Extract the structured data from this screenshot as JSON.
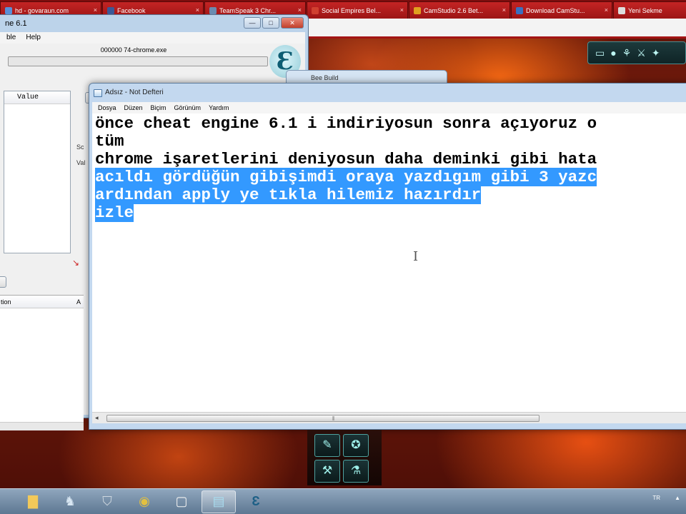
{
  "browser": {
    "tabs": [
      {
        "label": "hd - govaraun.com",
        "icon_color": "#5a8fd6"
      },
      {
        "label": "Facebook",
        "icon_color": "#3b5998"
      },
      {
        "label": "TeamSpeak 3 Chr...",
        "icon_color": "#6b8bb0"
      },
      {
        "label": "Social Empires Bel...",
        "icon_color": "#d04030"
      },
      {
        "label": "CamStudio 2.6 Bet...",
        "icon_color": "#e0a020"
      },
      {
        "label": "Download CamStu...",
        "icon_color": "#3a70c0"
      },
      {
        "label": "Yeni Sekme",
        "icon_color": "#dddddd"
      }
    ],
    "tab_close_glyph": "×"
  },
  "cheat_engine": {
    "title": "ne 6.1",
    "menu": [
      "ble",
      "Help"
    ],
    "process": "000000 74-chrome.exe",
    "list_header": "Value",
    "label_sc": "Sc",
    "label_val": "Val",
    "table_head_left": "tion",
    "table_head_right": "A",
    "logo_glyph": "Ɛ"
  },
  "background_window": {
    "title": "Bee Build"
  },
  "notepad": {
    "title": "Adsız - Not Defteri",
    "menu": [
      "Dosya",
      "Düzen",
      "Biçim",
      "Görünüm",
      "Yardım"
    ],
    "lines": [
      {
        "text": "önce cheat engine 6.1 i indiriyosun sonra açıyoruz o",
        "selected": false
      },
      {
        "text": "tüm",
        "selected": false
      },
      {
        "text": "chrome işaretlerini deniyosun daha deminki gibi hata",
        "selected": false
      },
      {
        "text": "acıldı gördüğün gibişimdi oraya yazdıgım gibi 3 yazc",
        "selected": true
      },
      {
        "text": "ardından apply ye tıkla hilemiz hazırdır",
        "selected": true
      },
      {
        "text": "izle",
        "selected": true
      }
    ],
    "caret_glyph": "I"
  },
  "window_controls": {
    "minimize": "—",
    "maximize": "□",
    "close": "✕"
  },
  "taskbar": {
    "tray_lang": "TR",
    "tray_glyph": "▲"
  },
  "colors": {
    "selection": "#3399ff",
    "browser_tab_red": "#a41616"
  }
}
